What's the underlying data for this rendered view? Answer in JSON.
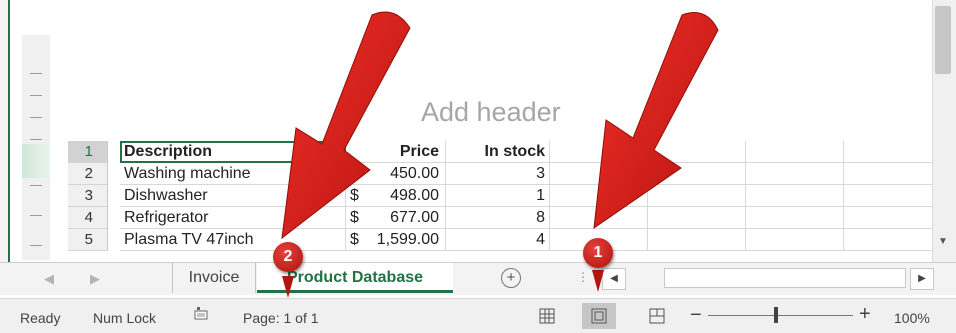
{
  "page": {
    "header_placeholder": "Add header"
  },
  "rows": {
    "numbers": [
      "1",
      "2",
      "3",
      "4",
      "5"
    ]
  },
  "table": {
    "headers": {
      "description": "Description",
      "price": "Price",
      "in_stock": "In stock"
    },
    "items": [
      {
        "description": "Washing machine",
        "currency": "$",
        "price": "450.00",
        "in_stock": "3"
      },
      {
        "description": "Dishwasher",
        "currency": "$",
        "price": "498.00",
        "in_stock": "1"
      },
      {
        "description": "Refrigerator",
        "currency": "$",
        "price": "677.00",
        "in_stock": "8"
      },
      {
        "description": "Plasma TV 47inch",
        "currency": "$",
        "price": "1,599.00",
        "in_stock": "4"
      }
    ]
  },
  "sheet_tabs": {
    "tabs": [
      {
        "label": "Invoice",
        "active": false
      },
      {
        "label": "Product Database",
        "active": true
      }
    ],
    "add_sheet_symbol": "+",
    "nav_prev": "◀",
    "nav_next": "▶"
  },
  "status_bar": {
    "ready": "Ready",
    "num_lock": "Num Lock",
    "page_info": "Page: 1 of 1",
    "zoom_minus": "−",
    "zoom_plus": "+",
    "zoom_level": "100%",
    "zoom_fraction": 0.47
  },
  "annotations": {
    "badges": [
      "1",
      "2"
    ],
    "color": "#cc1f1a"
  },
  "colors": {
    "accent": "#217346",
    "annotation_red": "#d42019"
  },
  "icons": [
    "macro-record-icon",
    "normal-view-icon",
    "page-layout-view-icon",
    "page-break-preview-icon",
    "add-sheet-icon"
  ]
}
